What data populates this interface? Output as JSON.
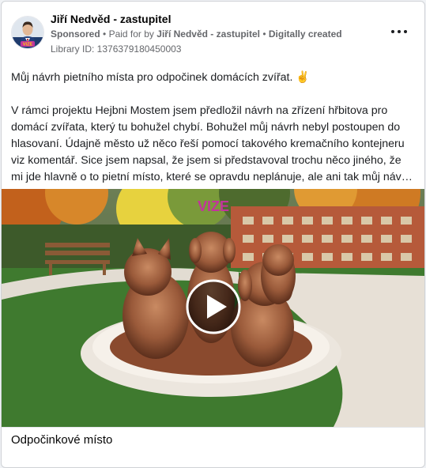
{
  "ad": {
    "page_name": "Jiří Nedvěd - zastupitel",
    "sponsored_label": "Sponsored",
    "paid_for_prefix": "Paid for by",
    "paid_for_name": "Jiří Nedvěd - zastupitel",
    "created_label": "Digitally created",
    "separator": "•",
    "library_id": "Library ID: 1376379180450003",
    "avatar_badge": "VIZE"
  },
  "post": {
    "lead": "Můj návrh pietního místa pro odpočinek domácích zvířat. ✌️",
    "body": "V rámci projektu Hejbni Mostem jsem předložil návrh na zřízení hřbitova pro domácí zvířata, který tu bohužel chybí. Bohužel můj návrh nebyl postoupen do hlasovaní. Údajně město už něco řeší pomocí takového kremačního kontejneru viz komentář. Sice jsem napsal, že jsem si představoval trochu něco jiného, že mi jde hlavně o to pietní místo, které se opravdu neplánuje, ale ani tak můj návrh bohuže…"
  },
  "media": {
    "watermark": "VIZE",
    "caption": "Odpočinkové místo"
  },
  "colors": {
    "brand_magenta": "#c2349b",
    "sculpture_bronze": "#9a5a3a",
    "grass": "#3f7a2f"
  }
}
